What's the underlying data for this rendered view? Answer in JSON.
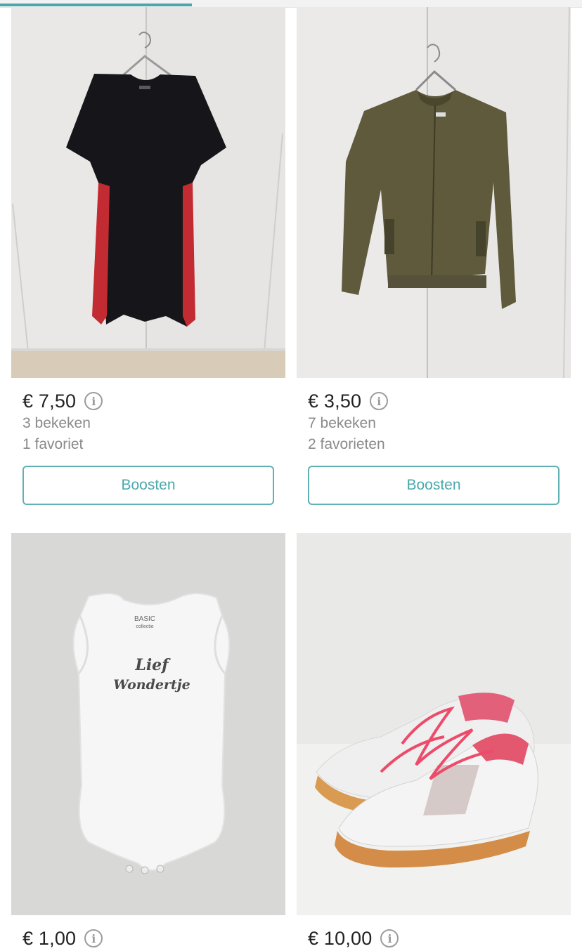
{
  "upload_progress": 0.33,
  "colors": {
    "accent": "#4aa8ad",
    "text": "#222222",
    "muted": "#8a8a8a"
  },
  "items": [
    {
      "image": "black-red-dress-photo",
      "price": "€ 7,50",
      "views": "3 bekeken",
      "favorites": "1 favoriet",
      "boost_label": "Boosten"
    },
    {
      "image": "olive-zip-jacket-photo",
      "price": "€ 3,50",
      "views": "7 bekeken",
      "favorites": "2 favorieten",
      "boost_label": "Boosten"
    },
    {
      "image": "white-baby-bodysuit-photo",
      "price": "€ 1,00",
      "print_line1": "Lief",
      "print_line2": "Wondertje",
      "brand_line1": "BASIC",
      "brand_line2": "collectie"
    },
    {
      "image": "pink-white-sneakers-photo",
      "price": "€ 10,00"
    }
  ]
}
